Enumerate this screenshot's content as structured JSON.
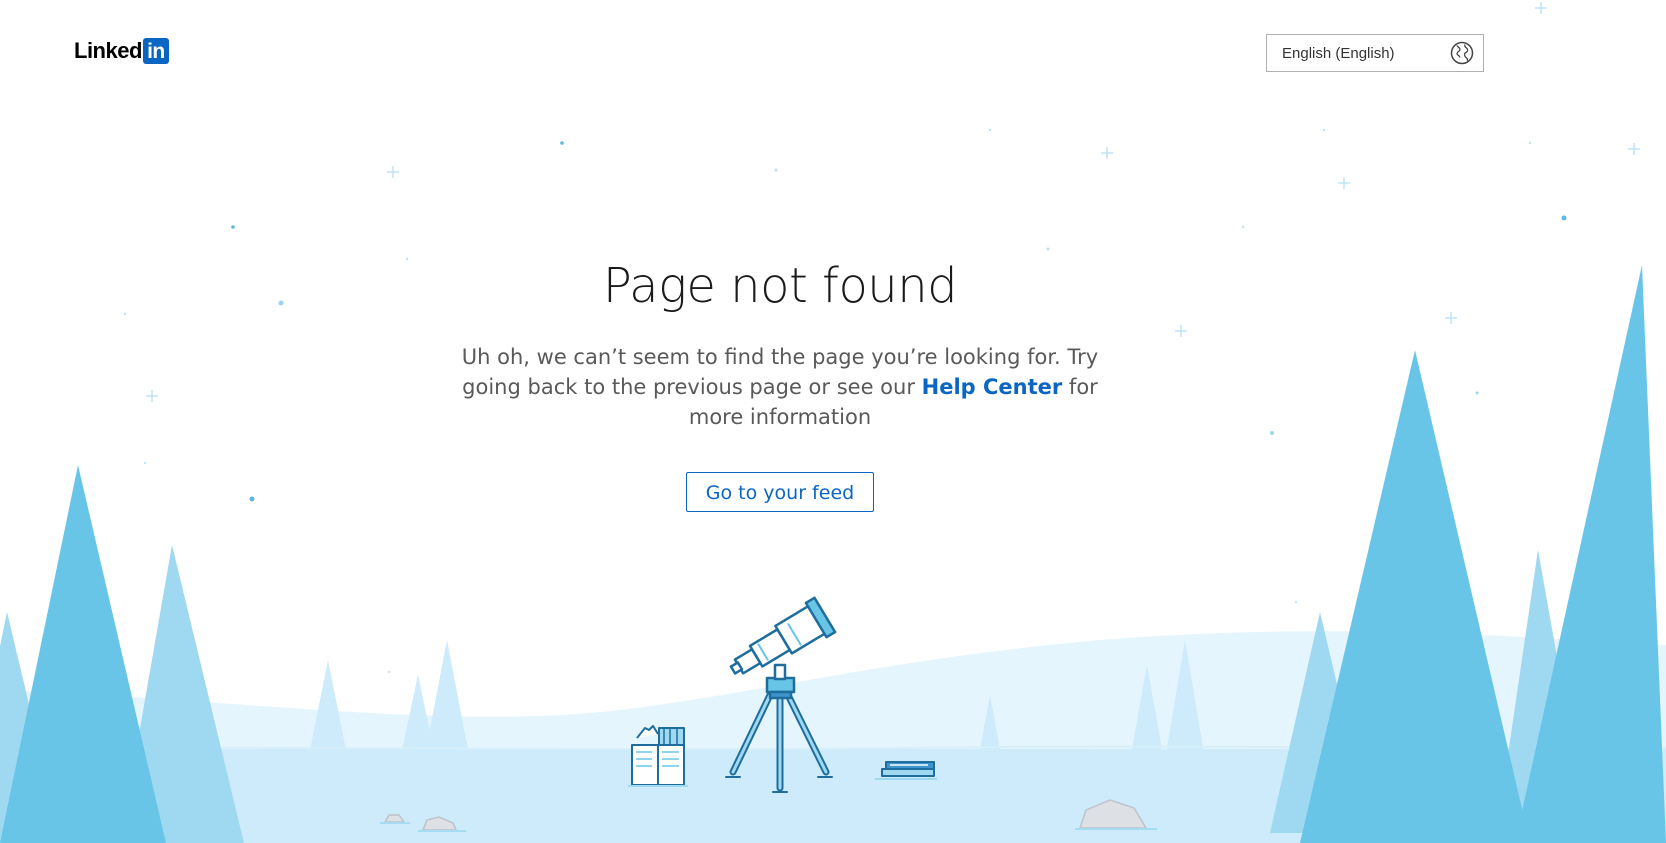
{
  "header": {
    "logo_word": "Linked",
    "logo_box": "in",
    "language": {
      "selected": "English (English)",
      "icon": "globe-icon"
    }
  },
  "main": {
    "title": "Page not found",
    "message_before": "Uh oh, we can’t seem to find the page you’re looking for. Try going back to the previous page or see our ",
    "help_link": "Help Center",
    "message_after": " for more information",
    "button": "Go to your feed"
  },
  "illustration": {
    "icons": [
      "telescope-icon",
      "books-icon",
      "stacked-books-icon",
      "rock-icon",
      "pine-tree-icon",
      "sparkle-icon"
    ]
  },
  "colors": {
    "brand_blue": "#0a66c2",
    "tree_dark": "#68c5e8",
    "tree_light": "#9fd8f1",
    "ground": "#cdebfa"
  }
}
